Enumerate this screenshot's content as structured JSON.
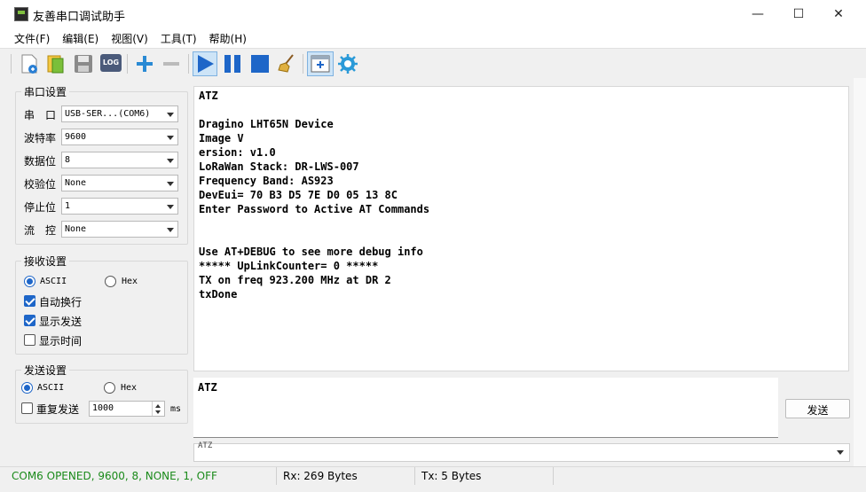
{
  "window": {
    "title": "友善串口调试助手",
    "minimize_glyph": "—",
    "maximize_glyph": "☐",
    "close_glyph": "✕"
  },
  "menu": [
    "文件(F)",
    "编辑(E)",
    "视图(V)",
    "工具(T)",
    "帮助(H)"
  ],
  "toolbar": {
    "log_label": "LOG"
  },
  "serial_settings": {
    "title": "串口设置",
    "port_label": "串　口",
    "port_value": "USB-SER...(COM6)",
    "baud_label": "波特率",
    "baud_value": "9600",
    "databits_label": "数据位",
    "databits_value": "8",
    "parity_label": "校验位",
    "parity_value": "None",
    "stopbits_label": "停止位",
    "stopbits_value": "1",
    "flow_label": "流　控",
    "flow_value": "None"
  },
  "receive_settings": {
    "title": "接收设置",
    "ascii_label": "ASCII",
    "hex_label": "Hex",
    "auto_newline_label": "自动换行",
    "show_send_label": "显示发送",
    "show_time_label": "显示时间"
  },
  "send_settings": {
    "title": "发送设置",
    "ascii_label": "ASCII",
    "hex_label": "Hex",
    "repeat_label": "重复发送",
    "interval_value": "1000",
    "interval_unit": "ms"
  },
  "receive_lines": [
    "ATZ",
    "",
    "Dragino LHT65N Device",
    "Image V",
    "ersion: v1.0",
    "LoRaWan Stack: DR-LWS-007",
    "Frequency Band: AS923",
    "DevEui= 70 B3 D5 7E D0 05 13 8C",
    "Enter Password to Active AT Commands",
    "",
    "",
    "Use AT+DEBUG to see more debug info",
    "***** UpLinkCounter= 0 *****",
    "TX on freq 923.200 MHz at DR 2",
    "txDone"
  ],
  "send": {
    "text": "ATZ",
    "button_label": "发送",
    "history_value": "ATZ"
  },
  "status": {
    "connection": "COM6 OPENED, 9600, 8, NONE, 1, OFF",
    "rx": "Rx: 269 Bytes",
    "tx": "Tx: 5 Bytes"
  },
  "colors": {
    "accent": "#1e66c8",
    "status_ok": "#1a8a1a"
  }
}
